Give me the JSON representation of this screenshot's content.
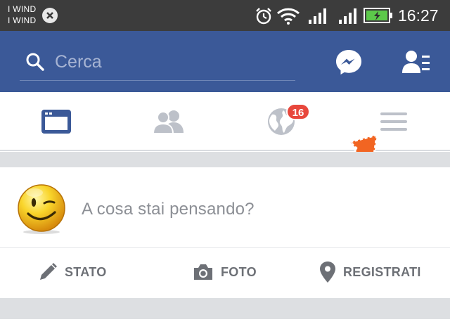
{
  "status_bar": {
    "carrier_1": "I WIND",
    "carrier_2": "I WIND",
    "time": "16:27",
    "icons": [
      "no-sim-icon",
      "alarm-icon",
      "wifi-icon",
      "signal-icon",
      "signal-icon",
      "battery-charging-icon"
    ]
  },
  "header": {
    "search_placeholder": "Cerca",
    "icons": [
      "search-icon",
      "messenger-icon",
      "friend-requests-icon"
    ]
  },
  "tabs": [
    {
      "name": "news-feed",
      "icon": "news-feed-icon",
      "active": true
    },
    {
      "name": "friends",
      "icon": "friends-icon",
      "active": false
    },
    {
      "name": "notifications",
      "icon": "globe-icon",
      "active": false,
      "badge": "16"
    },
    {
      "name": "more",
      "icon": "menu-icon",
      "active": false
    }
  ],
  "composer": {
    "prompt": "A cosa stai pensando?",
    "avatar": "winking-smiley-avatar",
    "actions": [
      {
        "label": "STATO",
        "icon": "pencil-icon"
      },
      {
        "label": "FOTO",
        "icon": "camera-icon"
      },
      {
        "label": "REGISTRATI",
        "icon": "location-pin-icon"
      }
    ]
  },
  "colors": {
    "brand": "#3b5998",
    "status_bar": "#3c3c3c",
    "badge": "#e8473c",
    "annotation_arrow": "#f26522",
    "battery": "#5cc94a"
  }
}
